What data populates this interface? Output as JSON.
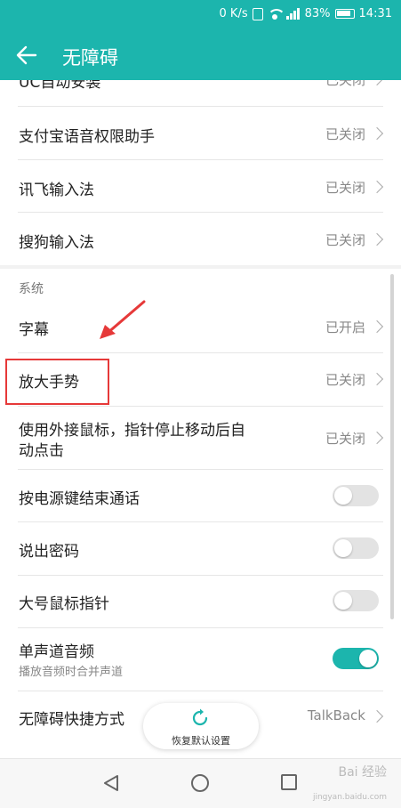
{
  "status_bar": {
    "net_speed": "0 K/s",
    "battery": "83%",
    "time": "14:31"
  },
  "header": {
    "title": "无障碍"
  },
  "items_top": [
    {
      "label": "UC自动安装",
      "value": "已关闭"
    },
    {
      "label": "支付宝语音权限助手",
      "value": "已关闭"
    },
    {
      "label": "讯飞输入法",
      "value": "已关闭"
    },
    {
      "label": "搜狗输入法",
      "value": "已关闭"
    }
  ],
  "system_section": {
    "header": "系统",
    "subtitles": {
      "caption": "已开启"
    },
    "items": [
      {
        "label": "字幕",
        "value": "已开启"
      },
      {
        "label": "放大手势",
        "value": "已关闭"
      },
      {
        "label": "使用外接鼠标，指针停止移动后自",
        "label2": "动点击",
        "value": "已关闭"
      }
    ],
    "toggles": [
      {
        "label": "按电源键结束通话",
        "on": false
      },
      {
        "label": "说出密码",
        "on": false
      },
      {
        "label": "大号鼠标指针",
        "on": false
      },
      {
        "label": "单声道音频",
        "sublabel": "播放音频时合并声道",
        "on": true
      }
    ],
    "shortcut": {
      "label": "无障碍快捷方式",
      "value": "TalkBack"
    }
  },
  "reset_button": {
    "label": "恢复默认设置"
  },
  "watermark": {
    "text": "Bai 经验",
    "sub": "jingyan.baidu.com"
  },
  "colors": {
    "accent": "#1cb5ad",
    "highlight": "#e63939"
  },
  "icons": [
    "back-arrow-icon",
    "vibrate-icon",
    "wifi-icon",
    "signal-icon",
    "battery-icon",
    "chevron-right-icon",
    "refresh-icon",
    "nav-back-icon",
    "nav-home-icon",
    "nav-recent-icon"
  ]
}
